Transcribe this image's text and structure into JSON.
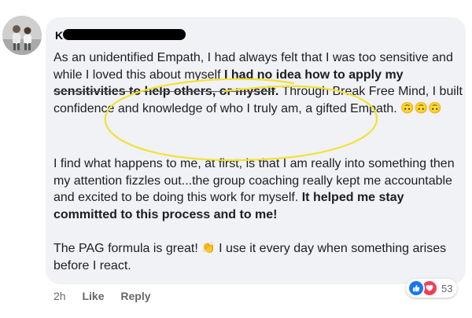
{
  "comment": {
    "author_name": "K",
    "paragraphs": {
      "p1": {
        "t1": "As an unidentified Empath, I had always felt that I was too sensitive and while I loved this about myself ",
        "b1": "I had no idea how to apply my ",
        "b1_strike": "sensitivities to help others, or myself",
        "b1_end": ".",
        "t2": " Through Break Free Mind, I built confidence and knowledge of who I truly am, a gifted Empath. ",
        "emoji": "🙃🙃🙃"
      },
      "p2": {
        "t1": "I find what happens to me, at first, is that I am really into something then my attention fizzles out...the group coaching really kept me accountable and excited to be doing this work for myself. ",
        "b1": "It helped me stay committed to this process and to me!"
      },
      "p3": {
        "t1": "The PAG formula is great! ",
        "emoji": "👏",
        "t2": " I use it every day when something arises before I react."
      }
    }
  },
  "actions": {
    "time": "2h",
    "like": "Like",
    "reply": "Reply"
  },
  "reactions": {
    "icons": [
      "like-icon",
      "love-icon"
    ],
    "count": "53"
  },
  "colors": {
    "bubble": "#f0f2f5",
    "highlight_oval": "#f2e235",
    "like": "#1877f2",
    "love": "#f33e58"
  }
}
